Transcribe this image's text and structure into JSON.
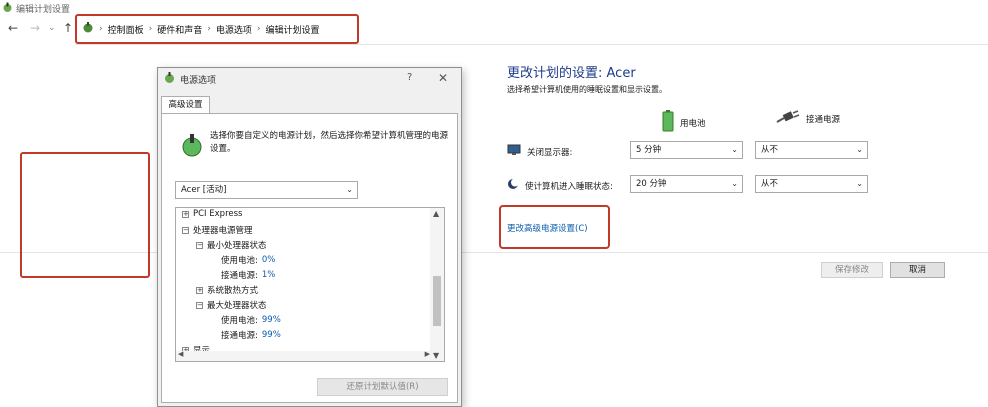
{
  "window": {
    "title": "编辑计划设置"
  },
  "nav": {
    "back": "←",
    "forward": "→",
    "recent": "⌄",
    "up": "↑",
    "breadcrumb": [
      "控制面板",
      "硬件和声音",
      "电源选项",
      "编辑计划设置"
    ],
    "separator": "›"
  },
  "main": {
    "title": "更改计划的设置: Acer",
    "description": "选择希望计算机使用的睡眠设置和显示设置。",
    "columns": {
      "battery": "用电池",
      "plugged": "接通电源"
    },
    "rows": [
      {
        "label": "关闭显示器:",
        "battery": "5 分钟",
        "plugged": "从不"
      },
      {
        "label": "使计算机进入睡眠状态:",
        "battery": "20 分钟",
        "plugged": "从不"
      }
    ],
    "advanced_link": "更改高级电源设置(C)",
    "save": "保存修改",
    "cancel": "取消"
  },
  "dialog": {
    "title": "电源选项",
    "help": "?",
    "close": "✕",
    "tab": "高级设置",
    "description": "选择你要自定义的电源计划，然后选择你希望计算机管理的电源设置。",
    "plan": "Acer [活动]",
    "tree": {
      "pci": "PCI Express",
      "processor": "处理器电源管理",
      "min_state": "最小处理器状态",
      "battery_label": "使用电池:",
      "plugged_label": "接通电源:",
      "min_battery": "0%",
      "min_plugged": "1%",
      "cooling": "系统散热方式",
      "max_state": "最大处理器状态",
      "max_battery": "99%",
      "max_plugged": "99%",
      "display": "显示"
    },
    "restore": "还原计划默认值(R)"
  },
  "colors": {
    "highlight": "#c0392b",
    "link": "#0b5cad",
    "title": "#1e3a8a"
  }
}
